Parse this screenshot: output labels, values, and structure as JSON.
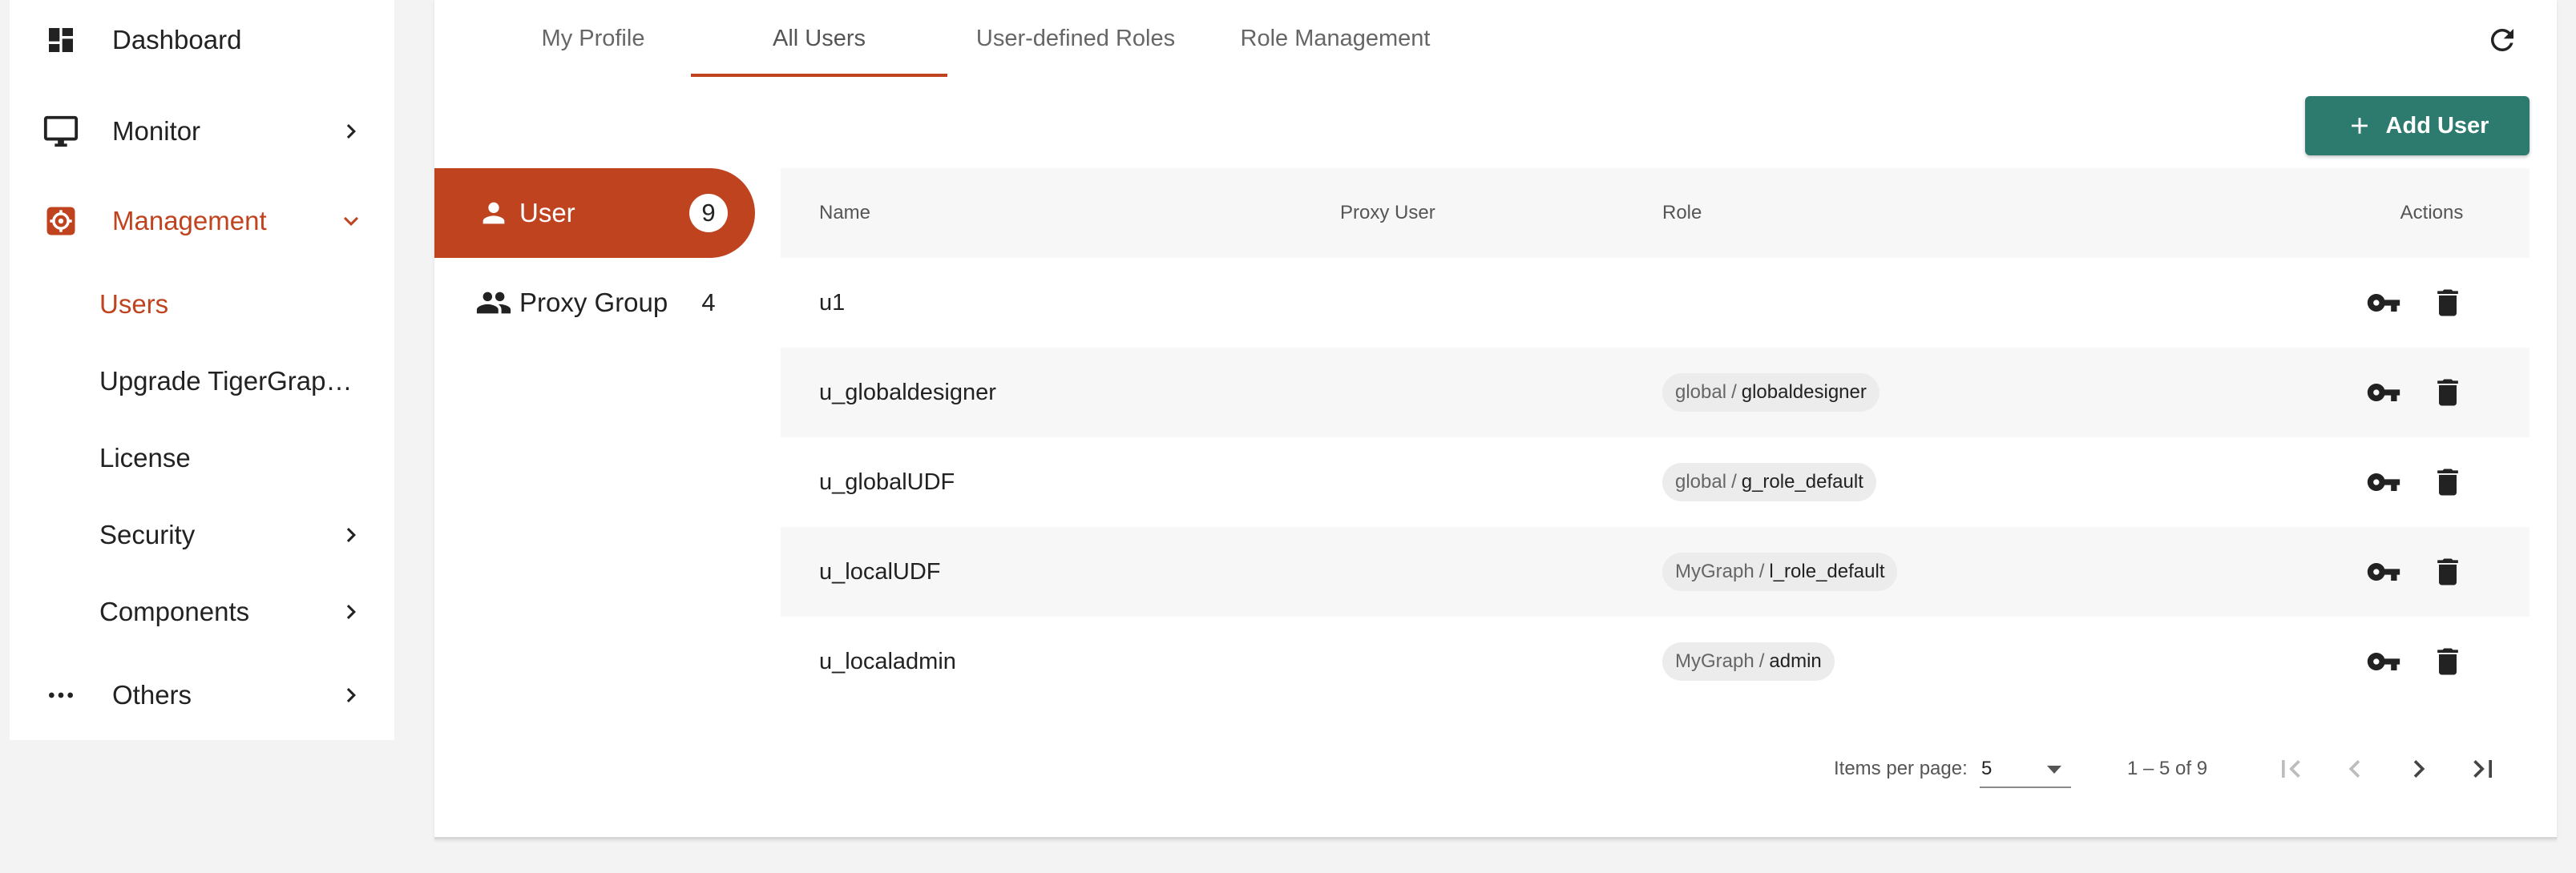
{
  "sidebar": {
    "items": [
      {
        "label": "Dashboard",
        "icon": "dashboard-icon"
      },
      {
        "label": "Monitor",
        "icon": "monitor-icon"
      },
      {
        "label": "Management",
        "icon": "settings-gear-icon"
      },
      {
        "label": "Others",
        "icon": "more-horizontal-icon"
      }
    ],
    "management_children": [
      {
        "label": "Users"
      },
      {
        "label": "Upgrade TigerGraph …"
      },
      {
        "label": "License"
      },
      {
        "label": "Security"
      },
      {
        "label": "Components"
      }
    ]
  },
  "tabs": [
    {
      "label": "My Profile"
    },
    {
      "label": "All Users"
    },
    {
      "label": "User-defined Roles"
    },
    {
      "label": "Role Management"
    }
  ],
  "toolbar": {
    "add_user_label": "Add User"
  },
  "categories": [
    {
      "label": "User",
      "count": "9"
    },
    {
      "label": "Proxy Group",
      "count": "4"
    }
  ],
  "table": {
    "headers": {
      "name": "Name",
      "proxy_user": "Proxy User",
      "role": "Role",
      "actions": "Actions"
    },
    "rows": [
      {
        "name": "u1",
        "proxy_user": "",
        "role_graph": "",
        "role_sep": "",
        "role_name": ""
      },
      {
        "name": "u_globaldesigner",
        "proxy_user": "",
        "role_graph": "global",
        "role_sep": "/",
        "role_name": "globaldesigner"
      },
      {
        "name": "u_globalUDF",
        "proxy_user": "",
        "role_graph": "global",
        "role_sep": "/",
        "role_name": "g_role_default"
      },
      {
        "name": "u_localUDF",
        "proxy_user": "",
        "role_graph": "MyGraph",
        "role_sep": "/",
        "role_name": "l_role_default"
      },
      {
        "name": "u_localadmin",
        "proxy_user": "",
        "role_graph": "MyGraph",
        "role_sep": "/",
        "role_name": "admin"
      }
    ]
  },
  "paginator": {
    "items_per_page_label": "Items per page:",
    "items_per_page_value": "5",
    "range_label": "1 – 5 of 9"
  },
  "colors": {
    "accent": "#c0431f",
    "primary_button": "#2d7b6f",
    "row_alt": "#f7f7f7"
  }
}
